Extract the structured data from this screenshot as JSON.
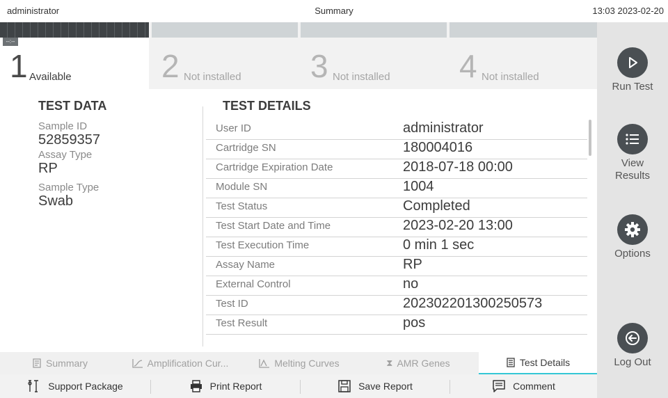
{
  "topbar": {
    "user": "administrator",
    "title": "Summary",
    "datetime": "13:03 2023-02-20"
  },
  "modules": [
    {
      "badge": "--:--",
      "num": "1",
      "label": "Available"
    },
    {
      "num": "2",
      "label": "Not installed"
    },
    {
      "num": "3",
      "label": "Not installed"
    },
    {
      "num": "4",
      "label": "Not installed"
    }
  ],
  "side": {
    "run_test": "Run Test",
    "view_results": "View Results",
    "options": "Options",
    "log_out": "Log Out"
  },
  "test_data": {
    "heading": "TEST DATA",
    "sample_id_label": "Sample ID",
    "sample_id": "52859357",
    "assay_type_label": "Assay Type",
    "assay_type": "RP",
    "sample_type_label": "Sample Type",
    "sample_type": "Swab"
  },
  "test_details": {
    "heading": "TEST DETAILS",
    "rows": [
      {
        "label": "User ID",
        "value": "administrator"
      },
      {
        "label": "Cartridge SN",
        "value": "180004016"
      },
      {
        "label": "Cartridge Expiration Date",
        "value": "2018-07-18 00:00"
      },
      {
        "label": "Module SN",
        "value": "1004"
      },
      {
        "label": "Test Status",
        "value": "Completed"
      },
      {
        "label": "Test Start Date and Time",
        "value": "2023-02-20 13:00"
      },
      {
        "label": "Test Execution Time",
        "value": "0 min 1 sec"
      },
      {
        "label": "Assay Name",
        "value": "RP"
      },
      {
        "label": "External Control",
        "value": "no"
      },
      {
        "label": "Test ID",
        "value": "202302201300250573"
      },
      {
        "label": "Test Result",
        "value": "pos"
      }
    ]
  },
  "tabs": {
    "summary": "Summary",
    "amplification": "Amplification Cur...",
    "melting": "Melting Curves",
    "amr": "AMR Genes",
    "details": "Test Details"
  },
  "actions": {
    "support": "Support Package",
    "print": "Print Report",
    "save": "Save Report",
    "comment": "Comment"
  },
  "colors": {
    "accent": "#34c7d6",
    "dark": "#4a4f53"
  }
}
